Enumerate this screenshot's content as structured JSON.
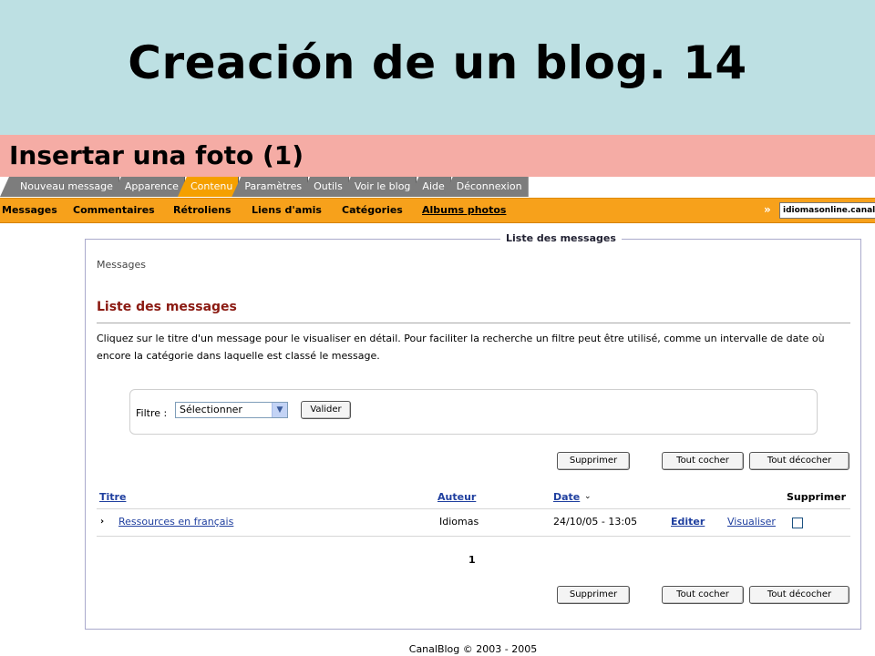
{
  "slide": {
    "title": "Creación de un blog. 14",
    "subtitle": "Insertar una foto (1)"
  },
  "tabs": [
    {
      "label": "Nouveau message",
      "active": false
    },
    {
      "label": "Apparence",
      "active": false
    },
    {
      "label": "Contenu",
      "active": true
    },
    {
      "label": "Paramètres",
      "active": false
    },
    {
      "label": "Outils",
      "active": false
    },
    {
      "label": "Voir le blog",
      "active": false
    },
    {
      "label": "Aide",
      "active": false
    },
    {
      "label": "Déconnexion",
      "active": false
    }
  ],
  "subnav": {
    "items": [
      "Messages",
      "Commentaires",
      "Rétroliens",
      "Liens d'amis",
      "Catégories",
      "Albums photos"
    ],
    "chevron": "»",
    "url": "idiomasonline.canalblog.com"
  },
  "panel": {
    "legend": "Liste des messages",
    "breadcrumb": "Messages",
    "heading": "Liste des messages",
    "description": "Cliquez sur le titre d'un message pour le visualiser en détail. Pour faciliter la recherche un filtre peut être utilisé, comme un intervalle de date où encore la catégorie dans laquelle est classé le message."
  },
  "filter": {
    "label": "Filtre :",
    "selected": "Sélectionner",
    "submit": "Valider"
  },
  "actions": {
    "delete": "Supprimer",
    "check_all": "Tout cocher",
    "uncheck_all": "Tout décocher"
  },
  "table": {
    "headers": {
      "title": "Titre",
      "author": "Auteur",
      "date": "Date",
      "delete": "Supprimer"
    },
    "rows": [
      {
        "title": "Ressources en français",
        "author": "Idiomas",
        "date": "24/10/05 - 13:05",
        "edit": "Editer",
        "view": "Visualiser",
        "checked": false
      }
    ]
  },
  "pagination": {
    "current": "1"
  },
  "footer": "CanalBlog © 2003 - 2005"
}
